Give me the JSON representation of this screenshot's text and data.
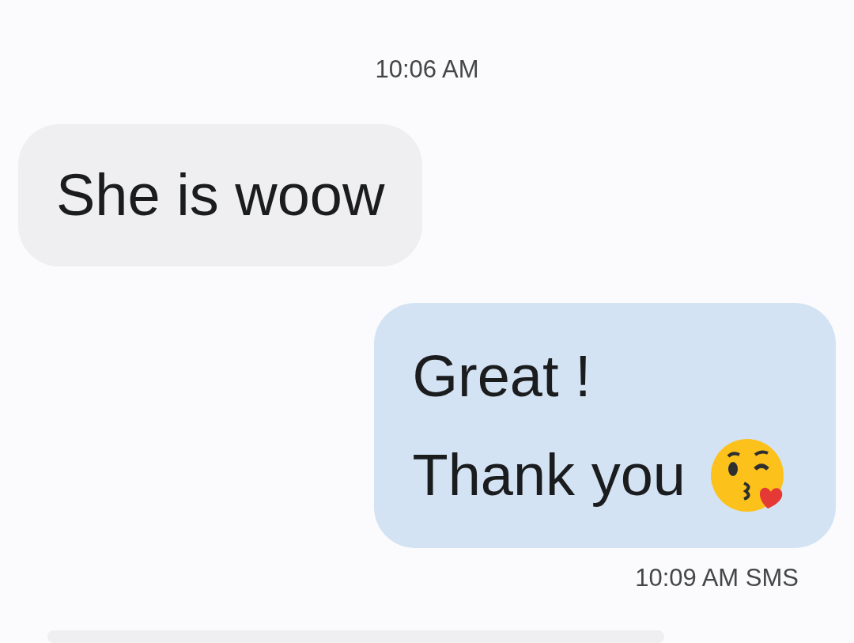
{
  "messages": [
    {
      "kind": "timestamp",
      "text": "10:06 AM"
    },
    {
      "kind": "incoming",
      "lines": [
        "She is woow"
      ]
    },
    {
      "kind": "outgoing",
      "lines": [
        "Great !",
        "Thank you"
      ],
      "emoji": true,
      "footer": "10:09 AM SMS"
    },
    {
      "kind": "partial"
    }
  ]
}
